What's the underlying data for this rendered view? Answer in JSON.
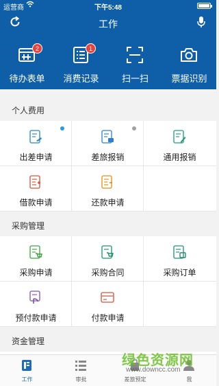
{
  "status_bar": {
    "carrier": "运营商",
    "time": "下午5:48"
  },
  "header": {
    "title": "工作"
  },
  "quick_actions": [
    {
      "label": "待办表单",
      "badge": "2",
      "icon": "form-icon"
    },
    {
      "label": "消费记录",
      "badge": "1",
      "icon": "list-icon"
    },
    {
      "label": "扫一扫",
      "badge": "",
      "icon": "scan-icon"
    },
    {
      "label": "票据识别",
      "badge": "",
      "icon": "camera-icon"
    }
  ],
  "sections": [
    {
      "title": "个人费用",
      "items": [
        {
          "label": "出差申请",
          "icon": "travel-apply-icon",
          "dot": "#2a9be0"
        },
        {
          "label": "差旅报销",
          "icon": "travel-reimburse-icon",
          "dot": "#a0a0a0"
        },
        {
          "label": "通用报销",
          "icon": "general-reimburse-icon"
        },
        {
          "label": "借款申请",
          "icon": "loan-apply-icon"
        },
        {
          "label": "还款申请",
          "icon": "repay-apply-icon"
        }
      ]
    },
    {
      "title": "采购管理",
      "items": [
        {
          "label": "采购申请",
          "icon": "purchase-apply-icon"
        },
        {
          "label": "采购合同",
          "icon": "purchase-contract-icon"
        },
        {
          "label": "采购订单",
          "icon": "purchase-order-icon"
        },
        {
          "label": "预付款申请",
          "icon": "prepay-apply-icon"
        },
        {
          "label": "付款申请",
          "icon": "payment-apply-icon"
        }
      ]
    },
    {
      "title": "资金管理",
      "items": []
    }
  ],
  "tabs": [
    {
      "label": "工作",
      "active": true
    },
    {
      "label": "审批",
      "active": false
    },
    {
      "label": "差旅预定",
      "active": false
    },
    {
      "label": "我",
      "active": false
    }
  ],
  "watermark": {
    "cn": "绿色资源网",
    "en": "www.downcc.com"
  },
  "colors": {
    "brand": "#0f5ea8",
    "badge": "#e8433b",
    "tab_active": "#1d6cb6"
  }
}
